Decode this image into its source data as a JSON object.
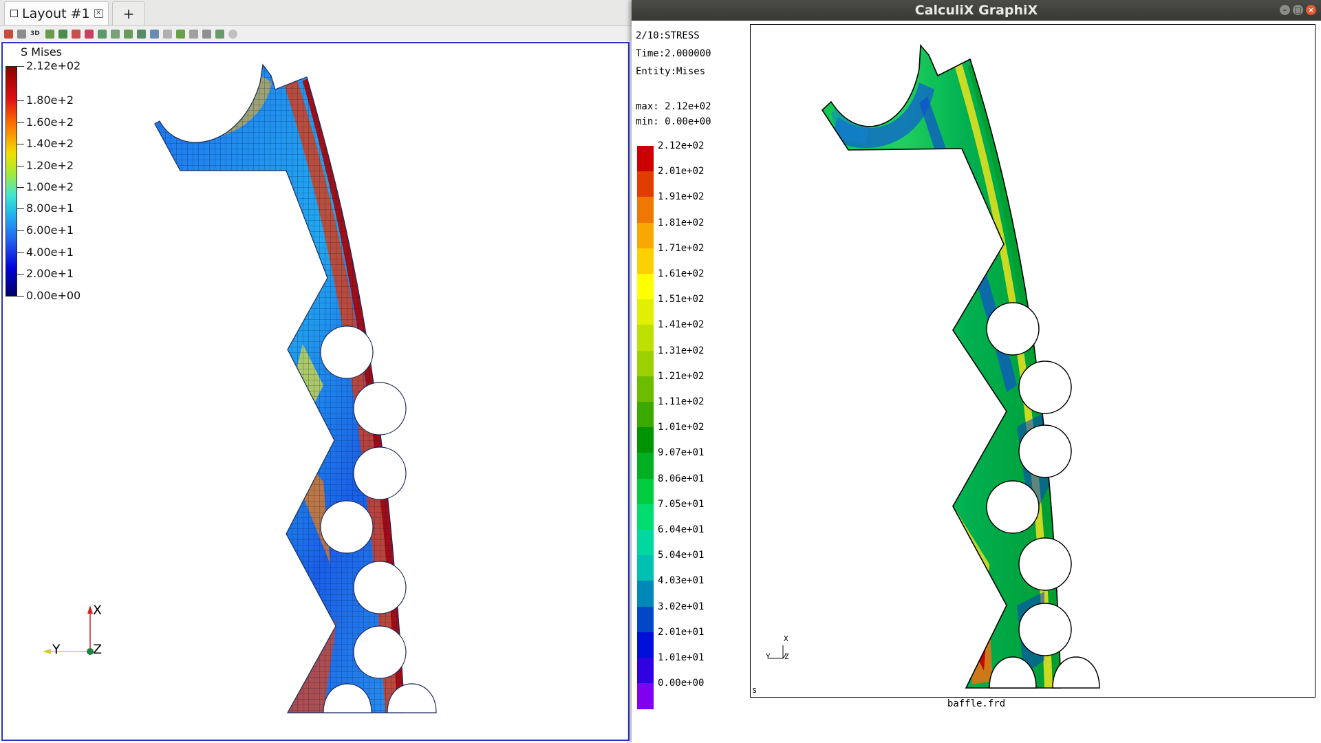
{
  "left": {
    "tabs": {
      "layout_label": "Layout #1",
      "add_label": "+"
    },
    "legend": {
      "title": "S Mises",
      "labels": [
        "2.12e+02",
        "1.80e+2",
        "1.60e+2",
        "1.40e+2",
        "1.20e+2",
        "1.00e+2",
        "8.00e+1",
        "6.00e+1",
        "4.00e+1",
        "2.00e+1",
        "0.00e+00"
      ]
    },
    "axes": {
      "x": "X",
      "y": "Y",
      "z": "Z"
    }
  },
  "right": {
    "window_title": "CalculiX GraphiX",
    "info": {
      "line1": "2/10:STRESS",
      "line2": "Time:2.000000",
      "line3": "Entity:Mises",
      "max": "max: 2.12e+02",
      "min": "min: 0.00e+00"
    },
    "legend": {
      "labels": [
        "2.12e+02",
        "2.01e+02",
        "1.91e+02",
        "1.81e+02",
        "1.71e+02",
        "1.61e+02",
        "1.51e+02",
        "1.41e+02",
        "1.31e+02",
        "1.21e+02",
        "1.11e+02",
        "1.01e+02",
        "9.07e+01",
        "8.06e+01",
        "7.05e+01",
        "6.04e+01",
        "5.04e+01",
        "4.03e+01",
        "3.02e+01",
        "2.01e+01",
        "1.01e+01",
        "0.00e+00"
      ],
      "colors": [
        "#cc0000",
        "#e23c00",
        "#f07800",
        "#f8a800",
        "#ffd000",
        "#ffff00",
        "#e0f000",
        "#bde000",
        "#9cd000",
        "#6cbc00",
        "#3aaa00",
        "#009400",
        "#00b020",
        "#00cc40",
        "#00dd70",
        "#00d8a0",
        "#00c0b0",
        "#0088b8",
        "#0048c8",
        "#0010d8",
        "#3000e0",
        "#8000f0"
      ]
    },
    "axes": {
      "x": "X",
      "y": "Y",
      "z": "Z"
    },
    "corner_label": "s",
    "filename": "baffle.frd"
  }
}
